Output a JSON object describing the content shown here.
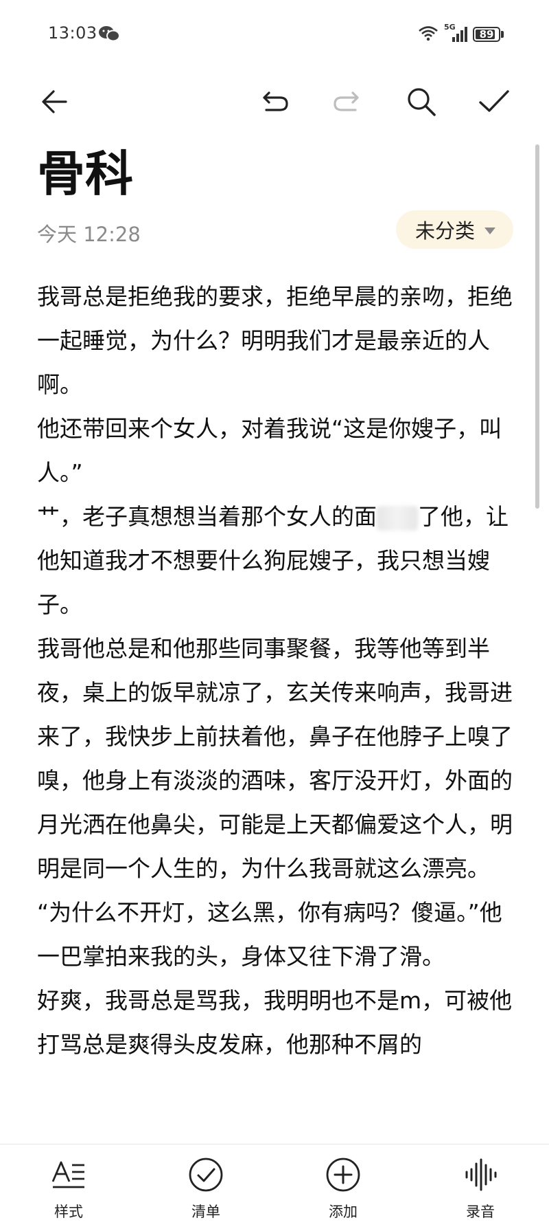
{
  "status_bar": {
    "time": "13:03",
    "network": "5G",
    "battery": "89",
    "battery_level": 0.89
  },
  "toolbar": {
    "back_icon": "back-arrow-icon",
    "undo_icon": "undo-icon",
    "redo_icon": "redo-icon",
    "search_icon": "search-icon",
    "done_icon": "checkmark-icon"
  },
  "note": {
    "title": "骨科",
    "date": "今天 12:28",
    "category": "未分类",
    "paragraphs": [
      "我哥总是拒绝我的要求，拒绝早晨的亲吻，拒绝一起睡觉，为什么？明明我们才是最亲近的人啊。",
      "他还带回来个女人，对着我说“这是你嫂子，叫人。”",
      "艹，老子真想想当着那个女人的面",
      "我哥他总是和他那些同事聚餐，我等他等到半夜，桌上的饭早就凉了，玄关传来响声，我哥进来了，我快步上前扶着他，鼻子在他脖子上嗅了嗅，他身上有淡淡的酒味，客厅没开灯，外面的月光洒在他鼻尖，可能是上天都偏爱这个人，明明是同一个人生的，为什么我哥就这么漂亮。",
      "“为什么不开灯，这么黑，你有病吗？傻逼。”他一巴掌拍来我的头，身体又往下滑了滑。",
      "好爽，我哥总是骂我，我明明也不是m，可被他打骂总是爽得头皮发麻，他那种不屑的"
    ],
    "paragraph3_tail": "了他，让他知道我才不想要什么狗屁嫂子，我只想当嫂子。"
  },
  "bottom_bar": {
    "items": [
      {
        "label": "样式",
        "icon": "text-style-icon"
      },
      {
        "label": "清单",
        "icon": "checklist-icon"
      },
      {
        "label": "添加",
        "icon": "add-icon"
      },
      {
        "label": "录音",
        "icon": "voice-record-icon"
      }
    ]
  },
  "colors": {
    "category_chip_bg": "#fdf5e4",
    "meta_text": "#8a8a8a",
    "redo_disabled": "#bdbdbd"
  }
}
